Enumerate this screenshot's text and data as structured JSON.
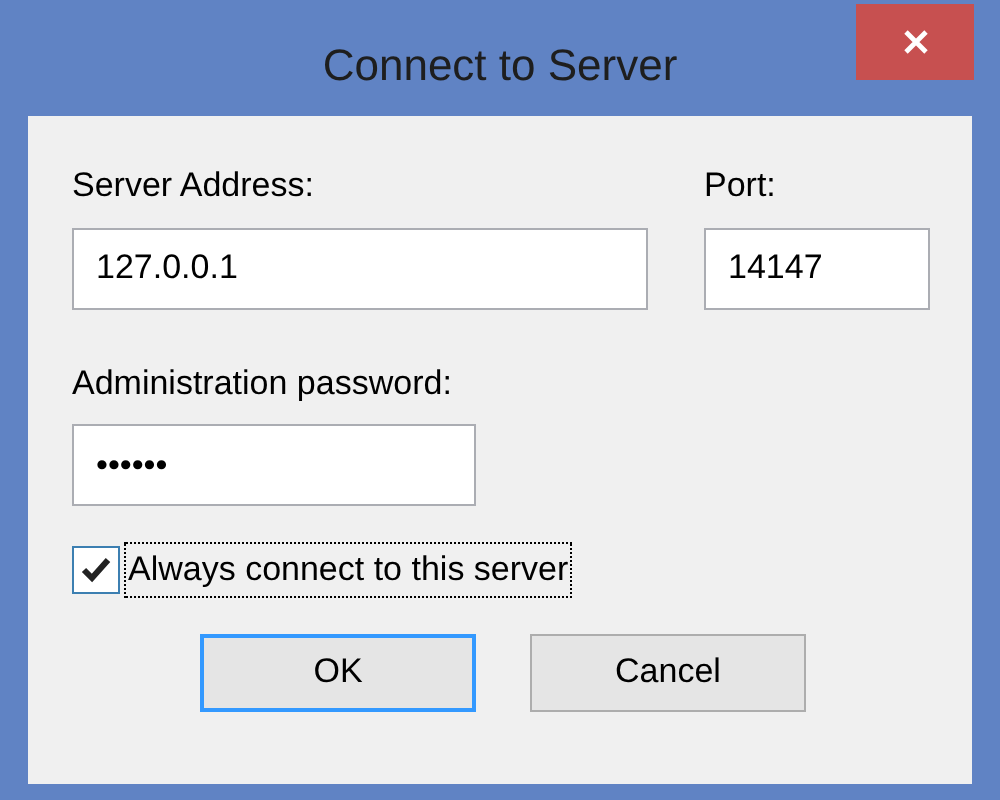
{
  "window": {
    "title": "Connect to Server"
  },
  "server_address": {
    "label": "Server Address:",
    "value": "127.0.0.1"
  },
  "port": {
    "label": "Port:",
    "value": "14147"
  },
  "password": {
    "label": "Administration password:",
    "value": "••••••"
  },
  "always_connect": {
    "label": "Always connect to this server",
    "checked": true
  },
  "buttons": [
    {
      "label": "OK",
      "default": true
    },
    {
      "label": "Cancel",
      "default": false
    }
  ]
}
